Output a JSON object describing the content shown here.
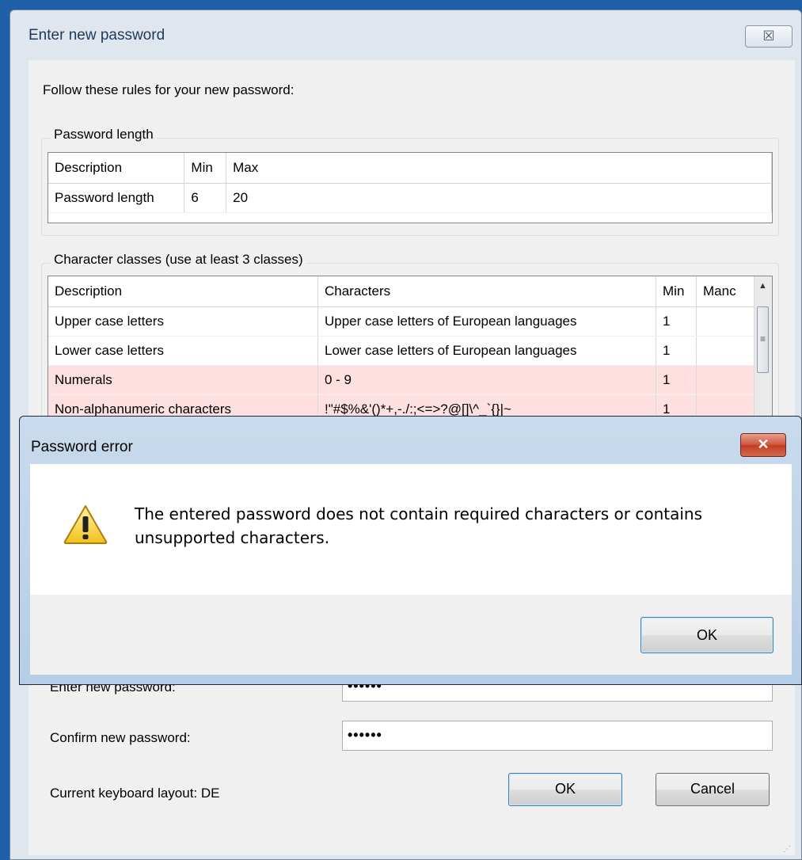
{
  "main_dialog": {
    "title": "Enter new password",
    "close_glyph": "☒",
    "intro": "Follow these rules for your new password:",
    "length_group": {
      "label": "Password length",
      "headers": [
        "Description",
        "Min",
        "Max"
      ],
      "rows": [
        [
          "Password length",
          "6",
          "20"
        ]
      ]
    },
    "classes_group": {
      "label": "Character classes (use at least 3 classes)",
      "headers": [
        "Description",
        "Characters",
        "Min",
        "Manc"
      ],
      "rows": [
        [
          "Upper case letters",
          "Upper case letters of European languages",
          "1",
          ""
        ],
        [
          "Lower case letters",
          "Lower case letters of European languages",
          "1",
          ""
        ],
        [
          "Numerals",
          "0 - 9",
          "1",
          ""
        ],
        [
          "Non-alphanumeric characters",
          "!\"#$%&'()*+,-./:;<=>?@[]\\^_`{}|~",
          "1",
          ""
        ]
      ]
    },
    "new_password_label": "Enter new password:",
    "new_password_value": "••••••",
    "confirm_label": "Confirm new password:",
    "confirm_value": "••••••",
    "keyboard_layout": "Current keyboard layout: DE",
    "ok_label": "OK",
    "cancel_label": "Cancel"
  },
  "error_dialog": {
    "title": "Password error",
    "close_glyph": "✕",
    "message": "The entered password does not contain required characters or contains unsupported characters.",
    "ok_label": "OK",
    "icon": "warning-icon"
  },
  "colors": {
    "error_row": "#fde0df",
    "title_bar": "#c9dbed",
    "close_red": "#c23c22"
  }
}
